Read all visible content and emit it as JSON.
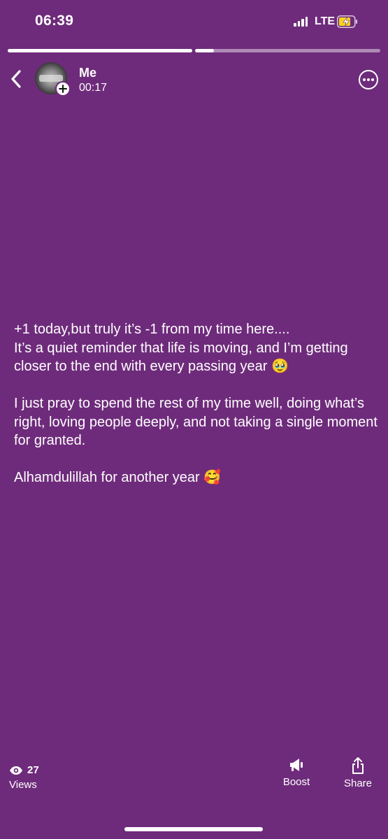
{
  "status_bar": {
    "time": "06:39",
    "network": "LTE",
    "battery_icon": "battery-charging-icon",
    "signal_icon": "signal-bars-icon"
  },
  "progress": {
    "segments": 2,
    "current_segment": 2,
    "current_fraction": 0.1
  },
  "header": {
    "back_icon": "chevron-left-icon",
    "name": "Me",
    "elapsed": "00:17",
    "add_icon": "plus-icon",
    "more_icon": "more-horizontal-icon"
  },
  "caption": {
    "line1": "+1 today,but truly it’s -1 from my time here....",
    "line2": "It’s a quiet reminder that life is moving, and I’m getting closer to the end with every passing year 🥹",
    "line3": "I just pray to spend the rest of my time well, doing what’s right, loving people deeply, and not taking a single moment for granted.",
    "line4": "Alhamdulillah for another year 🥰"
  },
  "footer": {
    "views_count": "27",
    "views_label": "Views",
    "boost_label": "Boost",
    "share_label": "Share"
  },
  "colors": {
    "background": "#6e2b7b",
    "foreground": "#ffffff",
    "battery_fill": "#f5d31d"
  }
}
